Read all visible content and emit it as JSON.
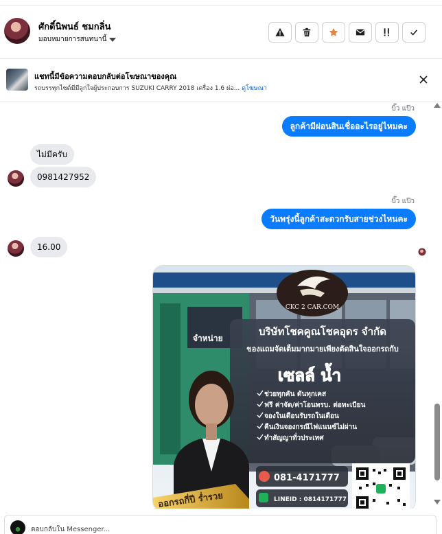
{
  "header": {
    "contact_name": "ศักดิ์นิพนธ์ ชมกลิ่น",
    "assign_label": "มอบหมายการสนทนานี้",
    "actions": [
      {
        "icon": "warning-icon"
      },
      {
        "icon": "trash-icon"
      },
      {
        "icon": "star-icon"
      },
      {
        "icon": "mail-icon"
      },
      {
        "icon": "follow-up-icon"
      },
      {
        "icon": "check-icon"
      }
    ],
    "accent_color": "#e8833a"
  },
  "ad_banner": {
    "title": "แชทนี้มีข้อความตอบกลับต่อโฆษณาของคุณ",
    "subtitle": "รถบรรทุกไซต์มีมีลูกใจผู้ประกอบการ SUZUKI CARRY 2018 เครื่อง 1.6 ผ่อ...",
    "link": "ดูโฆษณา",
    "close_icon": "close-icon"
  },
  "messages": [
    {
      "direction": "seen",
      "text": "บิ๊ว แป๊ว"
    },
    {
      "direction": "out",
      "text": "ลูกค้ามีผ่อนสินเชื่ออะไรอยู่ไหมคะ"
    },
    {
      "direction": "in",
      "text": "ไม่มีครับ"
    },
    {
      "direction": "in",
      "text": "0981427952"
    },
    {
      "direction": "seen",
      "text": "บิ๊ว แป๊ว"
    },
    {
      "direction": "out",
      "text": "วันพรุ่งนี้ลูกค้าสะดวกรับสายช่วงไหนคะ"
    },
    {
      "direction": "in",
      "text": "16.00"
    }
  ],
  "poster": {
    "logo_text": "CKC 2 CAR.COM",
    "company": "บริษัทโชคคูณโชคอุดร จำกัด",
    "tagline": "ของแถมจัดเต็มมากมายเพียงตัดสินใจออกรถกับ",
    "salesperson": "เซลล์ น้ำ",
    "sign_text": "จำหน่าย",
    "bullets": [
      "ช่วยทุกคัน ดันทุกเคส",
      "ฟรี ค่าจัด/ค่าโอนพรบ. ต่อทะเบียน",
      "จองในเดือนรับรถในเดือน",
      "คืนเงินจองกรณีไฟแนนซ์ไม่ผ่าน",
      "ทำสัญญาทั่วประเทศ"
    ],
    "phone": "081-4171777",
    "line_id": "LINEID : 0814171777",
    "ribbon_text": "ออกรถกี่ปี ร่ำรวย"
  },
  "composer": {
    "placeholder": "ตอบกลับใน Messenger..."
  }
}
